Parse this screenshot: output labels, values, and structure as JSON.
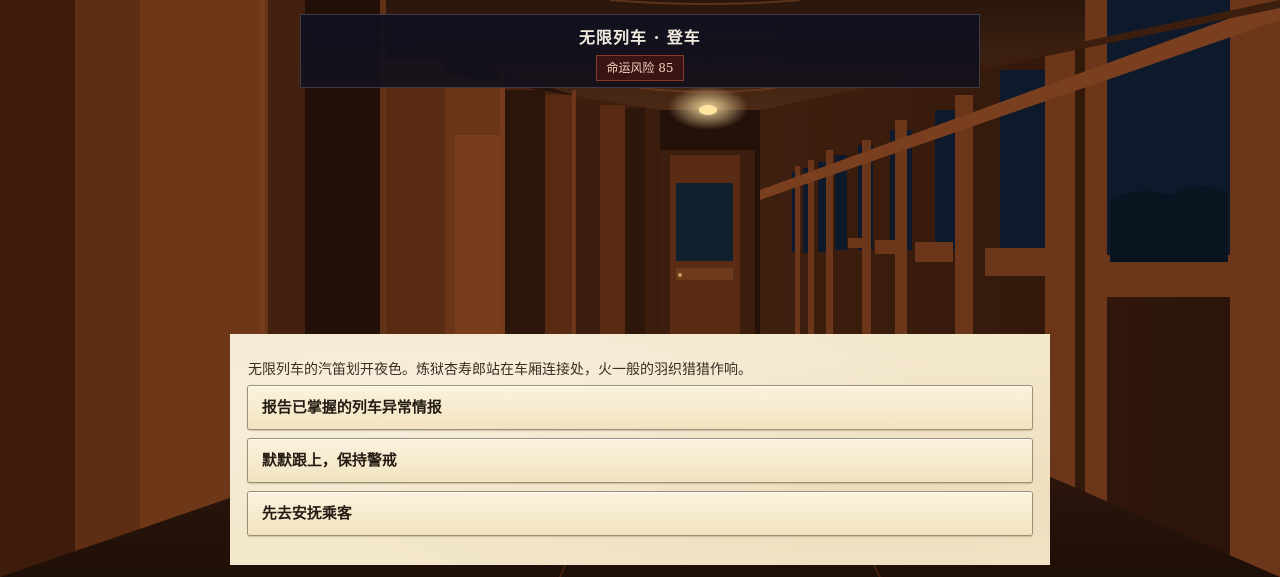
{
  "header": {
    "title": "无限列车 · 登车",
    "risk_label": "命运风险 85"
  },
  "dialog": {
    "narration": "无限列车的汽笛划开夜色。炼狱杏寿郎站在车厢连接处，火一般的羽织猎猎作响。",
    "choices": [
      {
        "label": "报告已掌握的列车异常情报"
      },
      {
        "label": "默默跟上，保持警戒"
      },
      {
        "label": "先去安抚乘客"
      }
    ]
  },
  "colors": {
    "header_bg": "#10121f",
    "risk_badge_bg": "#3a1412",
    "risk_badge_border": "#8a3a2c",
    "dialog_bg": "#f3e7cc",
    "choice_border": "#9d8f78",
    "wood": "#5a2f18",
    "night_window": "#0e1a2c"
  }
}
